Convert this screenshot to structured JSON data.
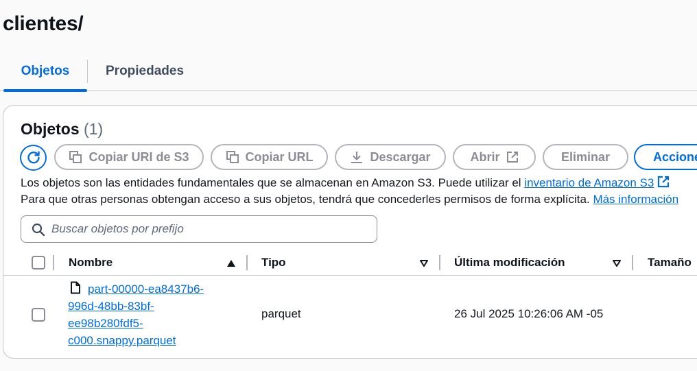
{
  "page": {
    "title": "clientes/"
  },
  "tabs": [
    {
      "label": "Objetos",
      "active": true
    },
    {
      "label": "Propiedades",
      "active": false
    }
  ],
  "objects_panel": {
    "heading": "Objetos",
    "count": "(1)",
    "toolbar": {
      "refresh_icon": "refresh-icon",
      "copy_uri_label": "Copiar URI de S3",
      "copy_url_label": "Copiar URL",
      "download_label": "Descargar",
      "open_label": "Abrir",
      "delete_label": "Eliminar",
      "actions_label": "Acciones"
    },
    "description": {
      "line1_text": "Los objetos son las entidades fundamentales que se almacenan en Amazon S3. Puede utilizar el ",
      "line1_link": "inventario de Amazon S3",
      "line2_text": "Para que otras personas obtengan acceso a sus objetos, tendrá que concederles permisos de forma explícita. ",
      "line2_link": "Más información"
    },
    "search": {
      "placeholder": "Buscar objetos por prefijo",
      "value": ""
    },
    "table": {
      "columns": {
        "name": "Nombre",
        "type": "Tipo",
        "modified": "Última modificación",
        "size": "Tamaño"
      },
      "rows": [
        {
          "name_lines": [
            "part-00000-ea8437b6-",
            "996d-48bb-83bf-",
            "ee98b280fdf5-",
            "c000.snappy.parquet"
          ],
          "type": "parquet",
          "modified": "26 Jul 2025 10:26:06 AM -05",
          "size": ""
        }
      ]
    }
  },
  "colors": {
    "accent": "#006ce0",
    "text": "#16191f",
    "disabled": "#8c8c94",
    "border": "#c6c6cd"
  }
}
